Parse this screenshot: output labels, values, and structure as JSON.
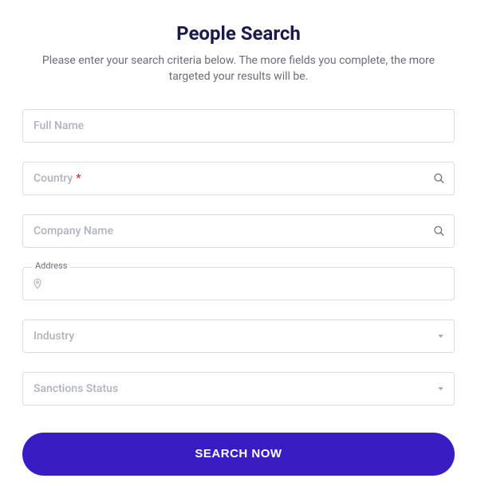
{
  "title": "People Search",
  "subtitle": "Please enter your search criteria below. The more fields you complete, the more targeted your results will be.",
  "fields": {
    "full_name": {
      "placeholder": "Full Name"
    },
    "country": {
      "placeholder": "Country",
      "required": true
    },
    "company": {
      "placeholder": "Company Name"
    },
    "address": {
      "label": "Address"
    },
    "industry": {
      "placeholder": "Industry"
    },
    "sanctions": {
      "placeholder": "Sanctions Status"
    }
  },
  "button": {
    "label": "SEARCH NOW"
  }
}
